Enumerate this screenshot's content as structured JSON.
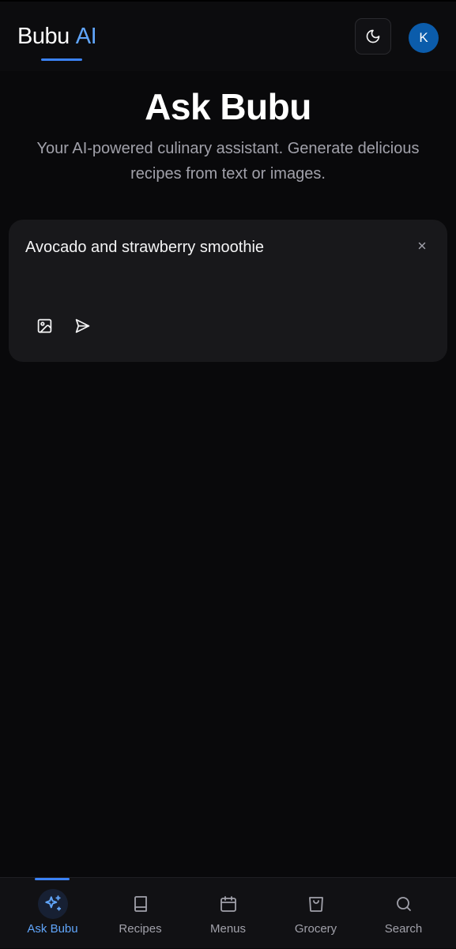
{
  "header": {
    "brand_primary": "Bubu",
    "brand_accent": "AI",
    "theme_toggle_icon": "moon-icon",
    "avatar_initial": "K"
  },
  "hero": {
    "title": "Ask Bubu",
    "subtitle": "Your AI-powered culinary assistant. Generate delicious recipes from text or images."
  },
  "composer": {
    "value": "Avocado and strawberry smoothie",
    "clear_icon": "close-icon",
    "image_icon": "image-icon",
    "send_icon": "send-icon"
  },
  "nav": {
    "items": [
      {
        "label": "Ask Bubu",
        "icon": "sparkles-icon",
        "active": true
      },
      {
        "label": "Recipes",
        "icon": "book-icon",
        "active": false
      },
      {
        "label": "Menus",
        "icon": "calendar-icon",
        "active": false
      },
      {
        "label": "Grocery",
        "icon": "shopping-bag-icon",
        "active": false
      },
      {
        "label": "Search",
        "icon": "search-icon",
        "active": false
      }
    ]
  },
  "colors": {
    "background": "#09090b",
    "card": "#18181b",
    "accent": "#3b82f6",
    "accent_text": "#60a5fa",
    "avatar": "#0b5cab"
  }
}
